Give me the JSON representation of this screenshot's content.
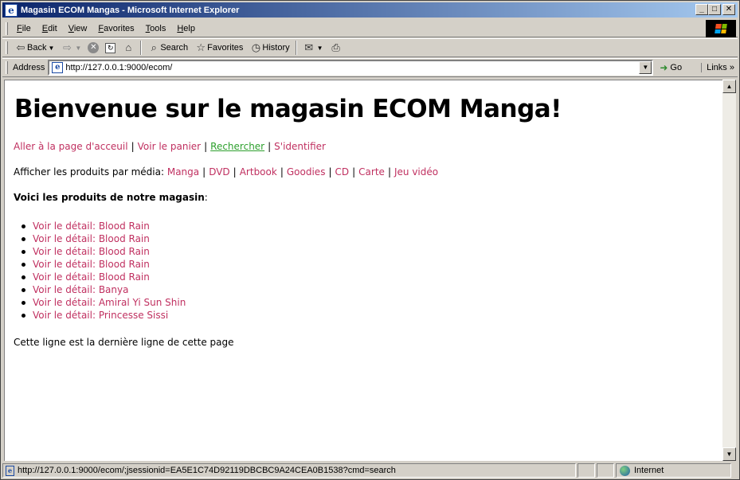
{
  "window": {
    "title": "Magasin ECOM Mangas - Microsoft Internet Explorer",
    "buttons": {
      "minimize": "_",
      "maximize": "□",
      "close": "✕"
    }
  },
  "menubar": {
    "items": [
      "File",
      "Edit",
      "View",
      "Favorites",
      "Tools",
      "Help"
    ]
  },
  "toolbar": {
    "back_label": "Back",
    "search_label": "Search",
    "favorites_label": "Favorites",
    "history_label": "History"
  },
  "address": {
    "label": "Address",
    "url": "http://127.0.0.1:9000/ecom/",
    "go_label": "Go",
    "links_label": "Links"
  },
  "page": {
    "title": "Bienvenue sur le magasin ECOM Manga!",
    "nav": {
      "home": "Aller à la page d'acceuil",
      "cart": "Voir le panier",
      "search": "Rechercher",
      "login": "S'identifier"
    },
    "media": {
      "prefix": "Afficher les produits par média: ",
      "items": [
        "Manga",
        "DVD",
        "Artbook",
        "Goodies",
        "CD",
        "Carte",
        "Jeu vidéo"
      ]
    },
    "products_heading": "Voici les produits de notre magasin",
    "products_heading_suffix": ":",
    "products": [
      "Voir le détail: Blood Rain",
      "Voir le détail: Blood Rain",
      "Voir le détail: Blood Rain",
      "Voir le détail: Blood Rain",
      "Voir le détail: Blood Rain",
      "Voir le détail: Banya",
      "Voir le détail: Amiral Yi Sun Shin",
      "Voir le détail: Princesse Sissi"
    ],
    "footer_line": "Cette ligne est la dernière ligne de cette page"
  },
  "status": {
    "text": "http://127.0.0.1:9000/ecom/;jsessionid=EA5E1C74D92119DBCBC9A24CEA0B1538?cmd=search",
    "zone": "Internet"
  },
  "colors": {
    "link": "#c03060",
    "visited_link": "#2ea02e",
    "titlebar_start": "#0a246a",
    "titlebar_end": "#a6caf0"
  }
}
